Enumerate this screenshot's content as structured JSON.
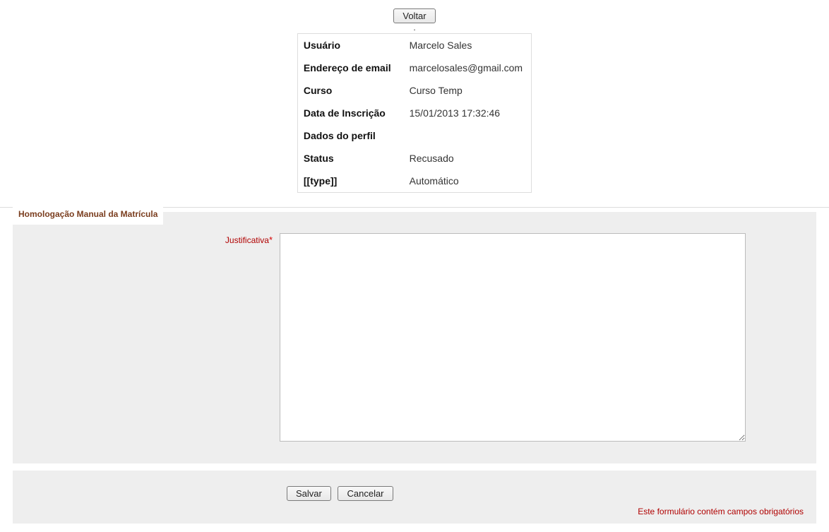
{
  "top": {
    "back_label": "Voltar"
  },
  "info": {
    "user_label": "Usuário",
    "user_value": "Marcelo Sales",
    "email_label": "Endereço de email",
    "email_value": "marcelosales@gmail.com",
    "course_label": "Curso",
    "course_value": "Curso Temp",
    "enroll_date_label": "Data de Inscrição",
    "enroll_date_value": "15/01/2013 17:32:46",
    "profile_data_label": "Dados do perfil",
    "status_label": "Status",
    "status_value": "Recusado",
    "type_label": "[[type]]",
    "type_value": "Automático"
  },
  "form": {
    "legend": "Homologação Manual da Matrícula",
    "justification_label": "Justificativa",
    "justification_value": ""
  },
  "actions": {
    "save_label": "Salvar",
    "cancel_label": "Cancelar",
    "required_note": "Este formulário contém campos obrigatórios"
  }
}
